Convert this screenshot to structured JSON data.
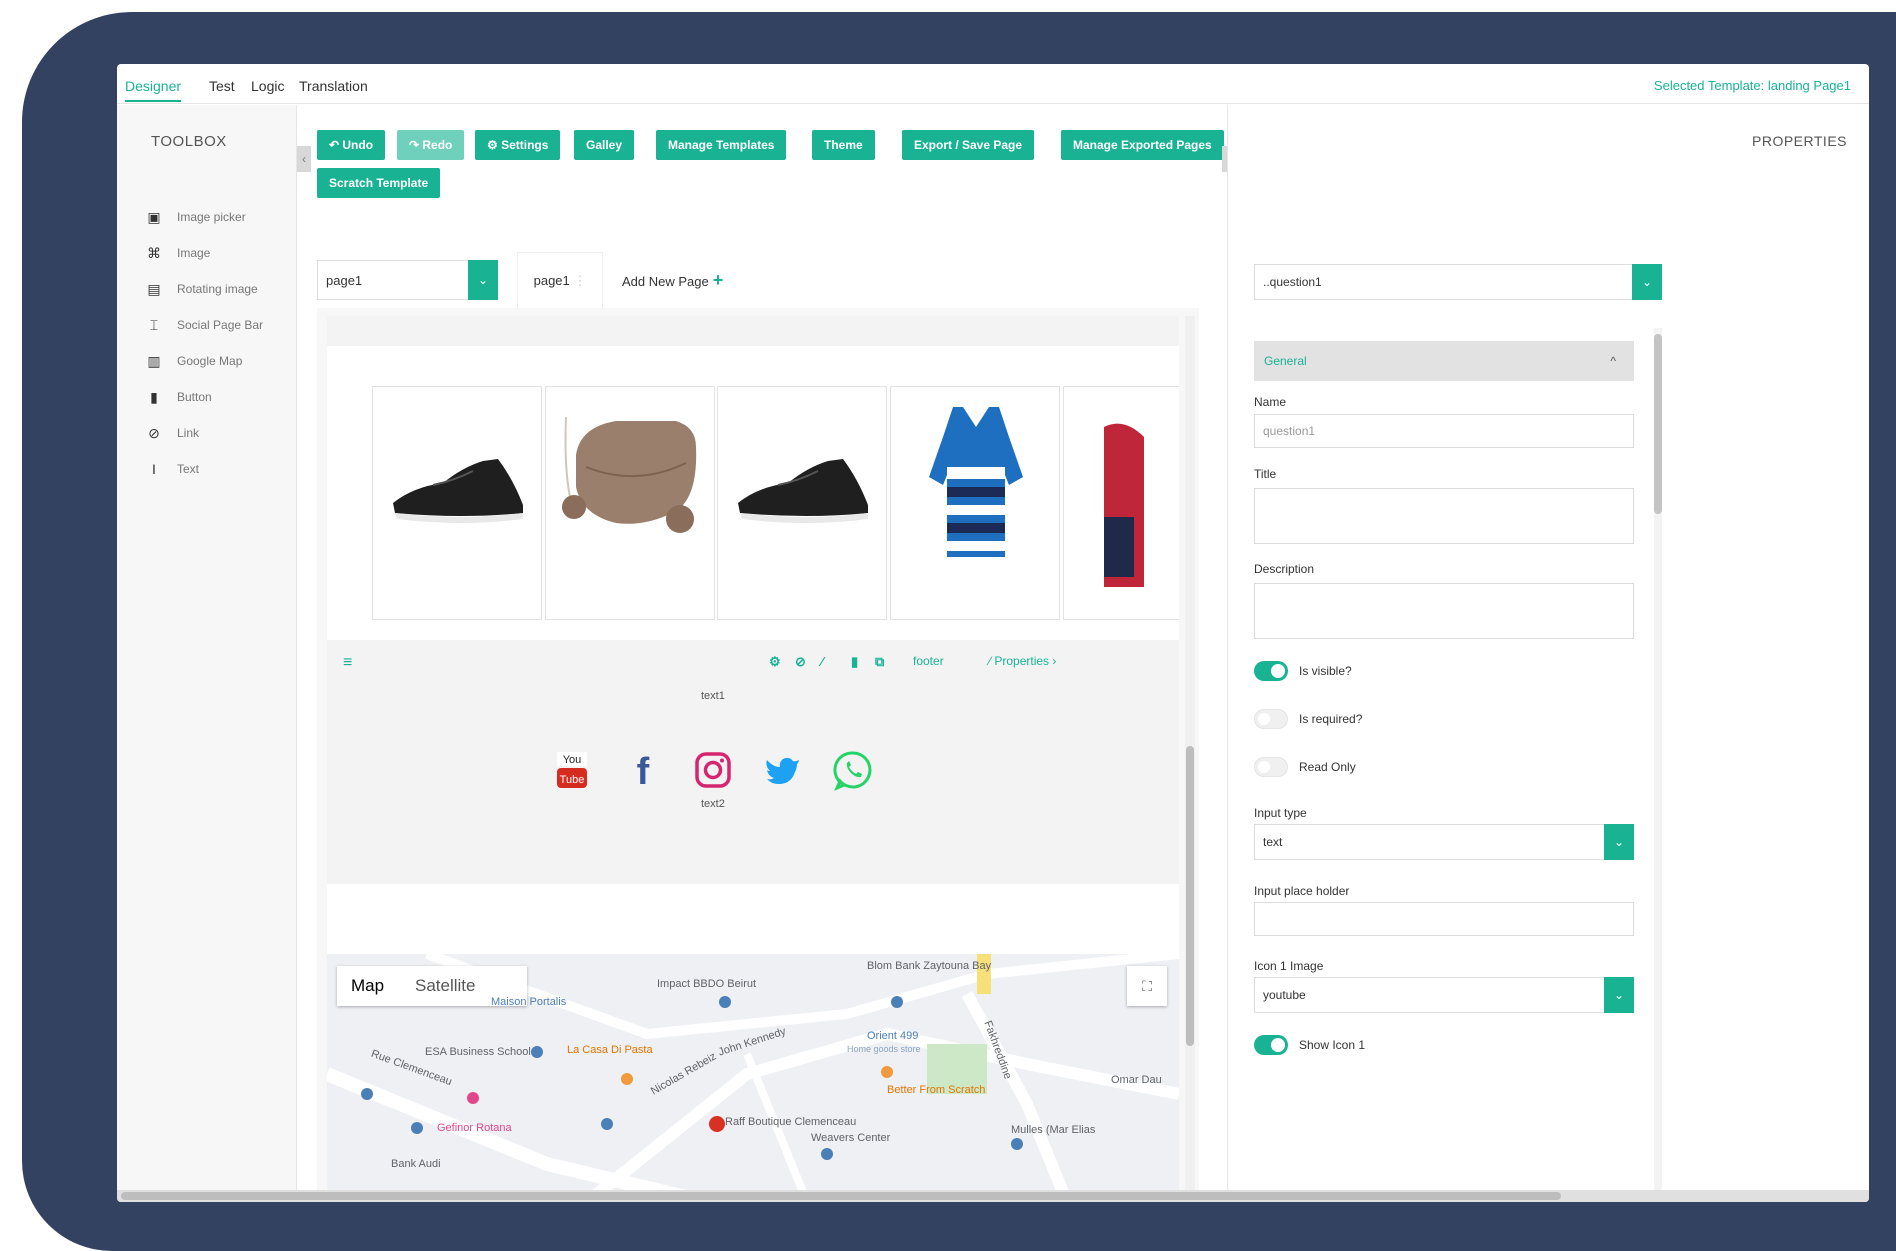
{
  "topnav": {
    "tabs": [
      "Designer",
      "Test",
      "Logic",
      "Translation"
    ],
    "selected_template": "Selected Template: landing Page1"
  },
  "toolbox": {
    "title": "TOOLBOX",
    "items": [
      {
        "label": "Image picker",
        "icon": "image-picker-icon"
      },
      {
        "label": "Image",
        "icon": "image-icon"
      },
      {
        "label": "Rotating image",
        "icon": "rotating-image-icon"
      },
      {
        "label": "Social Page Bar",
        "icon": "social-bar-icon"
      },
      {
        "label": "Google Map",
        "icon": "map-icon"
      },
      {
        "label": "Button",
        "icon": "button-icon"
      },
      {
        "label": "Link",
        "icon": "link-icon"
      },
      {
        "label": "Text",
        "icon": "text-icon"
      }
    ]
  },
  "toolbar": {
    "undo": "Undo",
    "redo": "Redo",
    "settings": "Settings",
    "gallery": "Galley",
    "manage_templates": "Manage Templates",
    "theme": "Theme",
    "export_save": "Export / Save Page",
    "manage_exported": "Manage Exported Pages",
    "scratch": "Scratch Template"
  },
  "pages": {
    "selected": "page1",
    "tab": "page1",
    "add_new": "Add New Page"
  },
  "footer_block": {
    "footer_label": "footer",
    "properties_label": "Properties",
    "text_top": "text1",
    "text_bottom": "text2",
    "social_icons": [
      "youtube",
      "facebook",
      "instagram",
      "twitter",
      "whatsapp"
    ]
  },
  "map": {
    "type_map": "Map",
    "type_satellite": "Satellite",
    "places": [
      "Maison Portalis",
      "Impact BBDO Beirut",
      "Blom Bank Zaytouna Bay",
      "ESA Business School",
      "La Casa Di Pasta",
      "John Kennedy",
      "Orient 499",
      "Home goods store",
      "Rue Clemenceau",
      "Nicolas Rebeiz",
      "Fakhreddine",
      "Omar Dau",
      "Gefinor Rotana",
      "Raff Boutique Clemenceau",
      "Weavers Center",
      "Better From Scratch",
      "Mulles (Mar Elias",
      "Bank Audi"
    ]
  },
  "properties": {
    "title": "PROPERTIES",
    "selected_question": "..question1",
    "section": "General",
    "name_label": "Name",
    "name_value": "question1",
    "title_label": "Title",
    "description_label": "Description",
    "is_visible": "Is visible?",
    "is_required": "Is required?",
    "read_only": "Read Only",
    "input_type_label": "Input type",
    "input_type_value": "text",
    "placeholder_label": "Input place holder",
    "icon1_label": "Icon 1 Image",
    "icon1_value": "youtube",
    "show_icon1": "Show Icon 1"
  },
  "colors": {
    "accent": "#19b394",
    "frame": "#344261"
  }
}
